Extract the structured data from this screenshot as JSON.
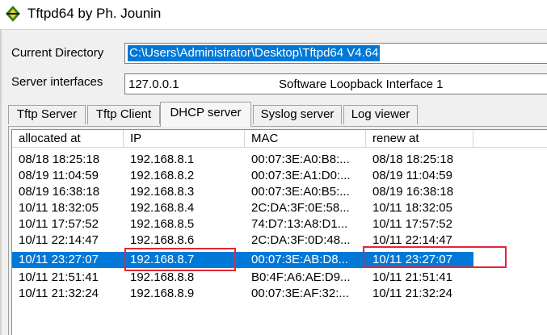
{
  "window": {
    "title": "Tftpd64 by Ph. Jounin"
  },
  "directory": {
    "label": "Current Directory",
    "value": "C:\\Users\\Administrator\\Desktop\\Tftpd64 V4.64"
  },
  "interfaces": {
    "label": "Server interfaces",
    "address": "127.0.0.1",
    "name": "Software Loopback Interface 1"
  },
  "tabs": [
    {
      "label": "Tftp Server"
    },
    {
      "label": "Tftp Client"
    },
    {
      "label": "DHCP server"
    },
    {
      "label": "Syslog server"
    },
    {
      "label": "Log viewer"
    }
  ],
  "active_tab": "DHCP server",
  "table": {
    "columns": [
      "allocated at",
      "IP",
      "MAC",
      "renew at"
    ],
    "rows": [
      {
        "allocated": "08/18 18:25:18",
        "ip": "192.168.8.1",
        "mac": "00:07:3E:A0:B8:...",
        "renew": "08/18 18:25:18"
      },
      {
        "allocated": "08/19 11:04:59",
        "ip": "192.168.8.2",
        "mac": "00:07:3E:A1:D0:...",
        "renew": "08/19 11:04:59"
      },
      {
        "allocated": "08/19 16:38:18",
        "ip": "192.168.8.3",
        "mac": "00:07:3E:A0:B5:...",
        "renew": "08/19 16:38:18"
      },
      {
        "allocated": "10/11 18:32:05",
        "ip": "192.168.8.4",
        "mac": "2C:DA:3F:0E:58...",
        "renew": "10/11 18:32:05"
      },
      {
        "allocated": "10/11 17:57:52",
        "ip": "192.168.8.5",
        "mac": "74:D7:13:A8:D1...",
        "renew": "10/11 17:57:52"
      },
      {
        "allocated": "10/11 22:14:47",
        "ip": "192.168.8.6",
        "mac": "2C:DA:3F:0D:48...",
        "renew": "10/11 22:14:47"
      },
      {
        "allocated": "10/11 23:27:07",
        "ip": "192.168.8.7",
        "mac": "00:07:3E:AB:D8...",
        "renew": "10/11 23:27:07"
      },
      {
        "allocated": "10/11 21:51:41",
        "ip": "192.168.8.8",
        "mac": "B0:4F:A6:AE:D9...",
        "renew": "10/11 21:51:41"
      },
      {
        "allocated": "10/11 21:32:24",
        "ip": "192.168.8.9",
        "mac": "00:07:3E:AF:32:...",
        "renew": "10/11 21:32:24"
      }
    ],
    "selected_index": 6
  },
  "colors": {
    "selection": "#0078d7",
    "highlight_box": "#e32636"
  }
}
